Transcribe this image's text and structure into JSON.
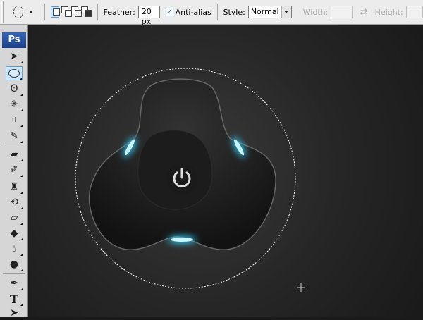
{
  "options_bar": {
    "feather_label": "Feather:",
    "feather_value": "20 px",
    "antialias_label": "Anti-alias",
    "antialias_checked": true,
    "style_label": "Style:",
    "style_value": "Normal",
    "width_label": "Width:",
    "height_label": "Height:"
  },
  "toolbox": {
    "logo": "Ps",
    "tools": [
      "move",
      "elliptical-marquee",
      "lasso",
      "magic-wand",
      "crop",
      "slice",
      "healing-brush",
      "brush",
      "clone-stamp",
      "history-brush",
      "eraser",
      "paint-bucket",
      "blur",
      "dodge",
      "pen",
      "type",
      "path-selection"
    ],
    "type_glyph": "T",
    "active_tool": "elliptical-marquee"
  },
  "canvas": {
    "glow_color": "#33d6ff",
    "power_glyph": "⏻"
  }
}
